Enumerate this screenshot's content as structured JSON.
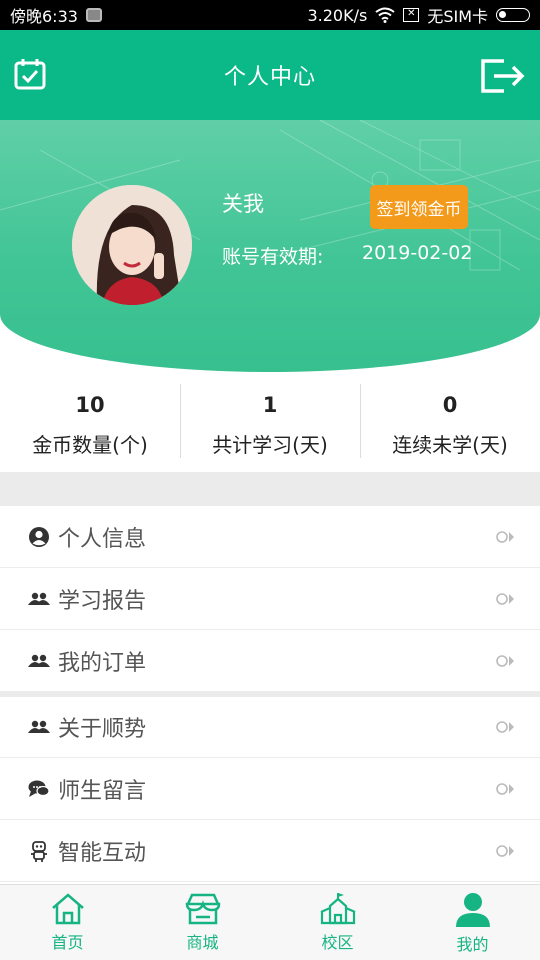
{
  "status_bar": {
    "time": "傍晚6:33",
    "speed": "3.20K/s",
    "sim": "无SIM卡"
  },
  "header": {
    "title": "个人中心"
  },
  "profile": {
    "name": "关我",
    "expire_label": "账号有效期:",
    "expire_date": "2019-02-02",
    "signin_button": "签到领金币"
  },
  "stats": [
    {
      "value": "10",
      "label": "金币数量(个)"
    },
    {
      "value": "1",
      "label": "共计学习(天)"
    },
    {
      "value": "0",
      "label": "连续未学(天)"
    }
  ],
  "menu": [
    {
      "label": "个人信息",
      "icon": "user-circle-icon"
    },
    {
      "label": "学习报告",
      "icon": "group-icon"
    },
    {
      "label": "我的订单",
      "icon": "group-icon"
    },
    {
      "label": "关于顺势",
      "icon": "group-icon"
    },
    {
      "label": "师生留言",
      "icon": "chat-icon"
    },
    {
      "label": "智能互动",
      "icon": "robot-icon"
    }
  ],
  "tabs": [
    {
      "label": "首页",
      "icon": "home-icon"
    },
    {
      "label": "商城",
      "icon": "shop-icon"
    },
    {
      "label": "校区",
      "icon": "school-icon"
    },
    {
      "label": "我的",
      "icon": "profile-icon"
    }
  ],
  "colors": {
    "primary": "#0bb888",
    "accent": "#f49a1a"
  }
}
